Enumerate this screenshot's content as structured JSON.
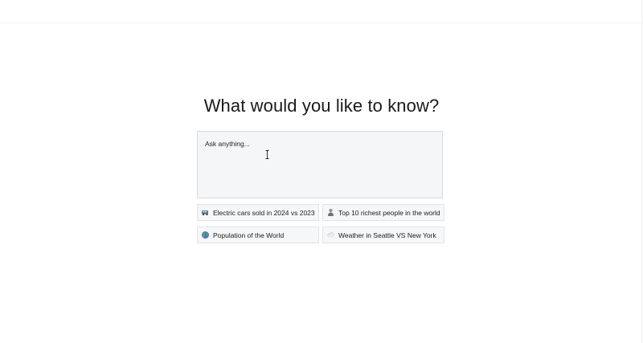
{
  "heading": "What would you like to know?",
  "ask": {
    "placeholder": "Ask anything..."
  },
  "suggestions": [
    {
      "label": "Electric cars sold in 2024 vs 2023",
      "icon": "car-icon"
    },
    {
      "label": "Top 10 richest people in the world",
      "icon": "person-icon"
    },
    {
      "label": "Population of the World",
      "icon": "globe-icon"
    },
    {
      "label": "Weather in Seattle VS New York",
      "icon": "cloud-icon"
    }
  ],
  "colors": {
    "input_background": "#f4f6f7",
    "input_border": "#d7dcdf",
    "suggestion_background": "#f6f7f8",
    "suggestion_border": "#e1e4e6"
  }
}
